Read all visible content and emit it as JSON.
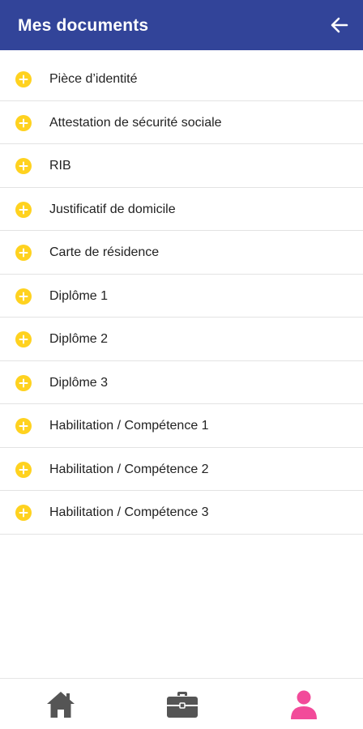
{
  "header": {
    "title": "Mes documents",
    "back_icon": "arrow-left-icon"
  },
  "documents": [
    {
      "label": "Pièce d’identité",
      "icon": "add-circle-icon"
    },
    {
      "label": "Attestation de sécurité sociale",
      "icon": "add-circle-icon"
    },
    {
      "label": "RIB",
      "icon": "add-circle-icon"
    },
    {
      "label": "Justificatif de domicile",
      "icon": "add-circle-icon"
    },
    {
      "label": "Carte de résidence",
      "icon": "add-circle-icon"
    },
    {
      "label": "Diplôme 1",
      "icon": "add-circle-icon"
    },
    {
      "label": "Diplôme 2",
      "icon": "add-circle-icon"
    },
    {
      "label": "Diplôme 3",
      "icon": "add-circle-icon"
    },
    {
      "label": "Habilitation / Compétence 1",
      "icon": "add-circle-icon"
    },
    {
      "label": "Habilitation / Compétence 2",
      "icon": "add-circle-icon"
    },
    {
      "label": "Habilitation / Compétence 3",
      "icon": "add-circle-icon"
    }
  ],
  "bottom_nav": {
    "items": [
      {
        "icon": "home-icon",
        "active": false
      },
      {
        "icon": "briefcase-icon",
        "active": false
      },
      {
        "icon": "user-icon",
        "active": true
      }
    ]
  },
  "colors": {
    "header_bg": "#324499",
    "add_icon": "#FFD21F",
    "nav_inactive": "#555555",
    "nav_active": "#F24B9A"
  }
}
